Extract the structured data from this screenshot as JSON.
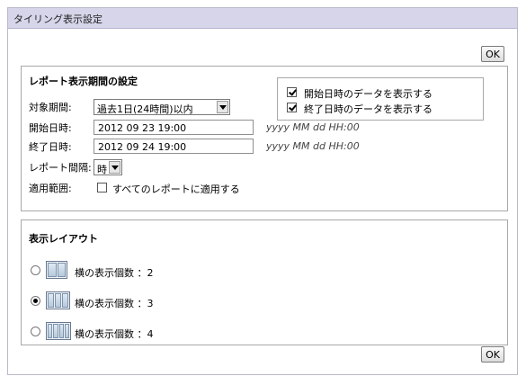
{
  "dialog": {
    "title": "タイリング表示設定",
    "ok_top": "OK",
    "ok_bottom": "OK"
  },
  "report_period": {
    "title": "レポート表示期間の設定",
    "target_label": "対象期間:",
    "target_value": "過去1日(24時間)以内",
    "start_label": "開始日時:",
    "start_value": "2012 09 23 19:00",
    "start_hint": "yyyy MM dd HH:00",
    "end_label": "終了日時:",
    "end_value": "2012 09 24 19:00",
    "end_hint": "yyyy MM dd HH:00",
    "interval_label": "レポート間隔:",
    "interval_value": "時",
    "scope_label": "適用範囲:",
    "scope_checkbox_label": "すべてのレポートに適用する",
    "scope_checked": false,
    "show_start_label": "開始日時のデータを表示する",
    "show_start_checked": true,
    "show_end_label": "終了日時のデータを表示する",
    "show_end_checked": true
  },
  "layout": {
    "title": "表示レイアウト",
    "options": [
      {
        "label": "横の表示個数 ：2",
        "selected": false,
        "icon": "two-column-layout-icon"
      },
      {
        "label": "横の表示個数 ：3",
        "selected": true,
        "icon": "three-column-layout-icon"
      },
      {
        "label": "横の表示個数 ：4",
        "selected": false,
        "icon": "four-column-layout-icon"
      }
    ]
  }
}
